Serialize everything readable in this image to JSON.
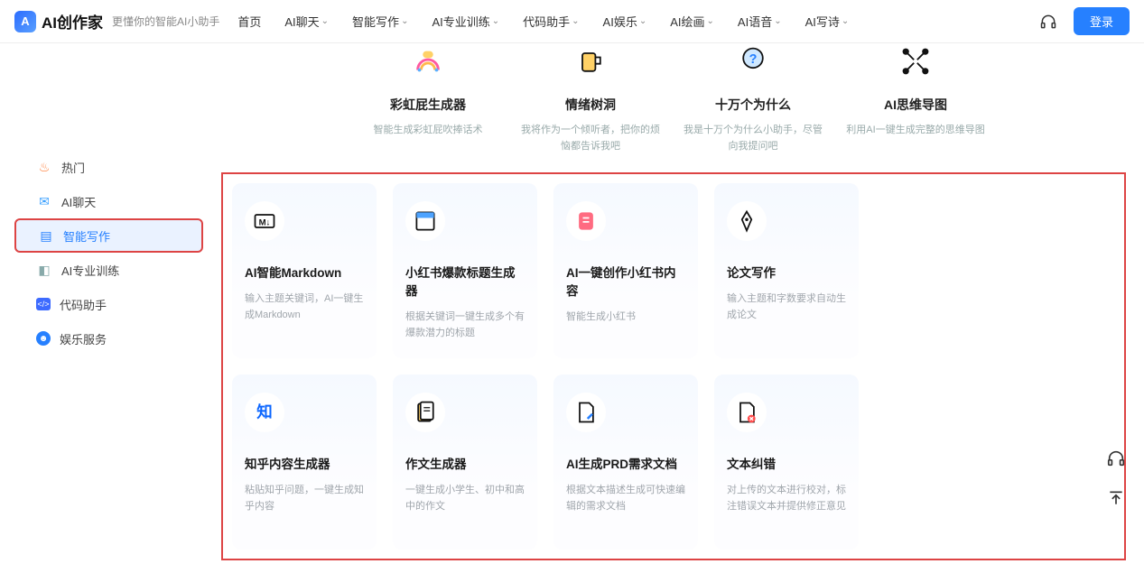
{
  "header": {
    "brand": "AI创作家",
    "tagline": "更懂你的智能AI小助手",
    "login_label": "登录",
    "nav": [
      {
        "label": "首页",
        "dropdown": false
      },
      {
        "label": "AI聊天",
        "dropdown": true
      },
      {
        "label": "智能写作",
        "dropdown": true
      },
      {
        "label": "AI专业训练",
        "dropdown": true
      },
      {
        "label": "代码助手",
        "dropdown": true
      },
      {
        "label": "AI娱乐",
        "dropdown": true
      },
      {
        "label": "AI绘画",
        "dropdown": true
      },
      {
        "label": "AI语音",
        "dropdown": true
      },
      {
        "label": "AI写诗",
        "dropdown": true
      }
    ]
  },
  "sidebar": {
    "items": [
      {
        "label": "热门",
        "icon": "fire"
      },
      {
        "label": "AI聊天",
        "icon": "chat"
      },
      {
        "label": "智能写作",
        "icon": "write",
        "active": true
      },
      {
        "label": "AI专业训练",
        "icon": "train"
      },
      {
        "label": "代码助手",
        "icon": "code"
      },
      {
        "label": "娱乐服务",
        "icon": "ent"
      }
    ]
  },
  "preview_row": [
    {
      "title": "彩虹屁生成器",
      "desc": "智能生成彩虹屁吹捧话术",
      "icon": "rainbow"
    },
    {
      "title": "情绪树洞",
      "desc": "我将作为一个倾听者，把你的烦恼都告诉我吧",
      "icon": "cup"
    },
    {
      "title": "十万个为什么",
      "desc": "我是十万个为什么小助手，尽管向我提问吧",
      "icon": "question"
    },
    {
      "title": "AI思维导图",
      "desc": "利用AI一键生成完整的思维导图",
      "icon": "mindmap"
    }
  ],
  "cards_row1": [
    {
      "title": "AI智能Markdown",
      "desc": "输入主题关键词，AI一键生成Markdown",
      "icon": "md"
    },
    {
      "title": "小红书爆款标题生成器",
      "desc": "根据关键词一键生成多个有爆款潜力的标题",
      "icon": "window"
    },
    {
      "title": "AI一键创作小红书内容",
      "desc": "智能生成小红书",
      "icon": "note"
    },
    {
      "title": "论文写作",
      "desc": "输入主题和字数要求自动生成论文",
      "icon": "pen"
    }
  ],
  "cards_row2": [
    {
      "title": "知乎内容生成器",
      "desc": "粘贴知乎问题，一键生成知乎内容",
      "icon": "zhi"
    },
    {
      "title": "作文生成器",
      "desc": "一键生成小学生、初中和高中的作文",
      "icon": "essay"
    },
    {
      "title": "AI生成PRD需求文档",
      "desc": "根据文本描述生成可快速编辑的需求文档",
      "icon": "prd"
    },
    {
      "title": "文本纠错",
      "desc": "对上传的文本进行校对，标注错误文本并提供修正意见",
      "icon": "correct"
    }
  ]
}
